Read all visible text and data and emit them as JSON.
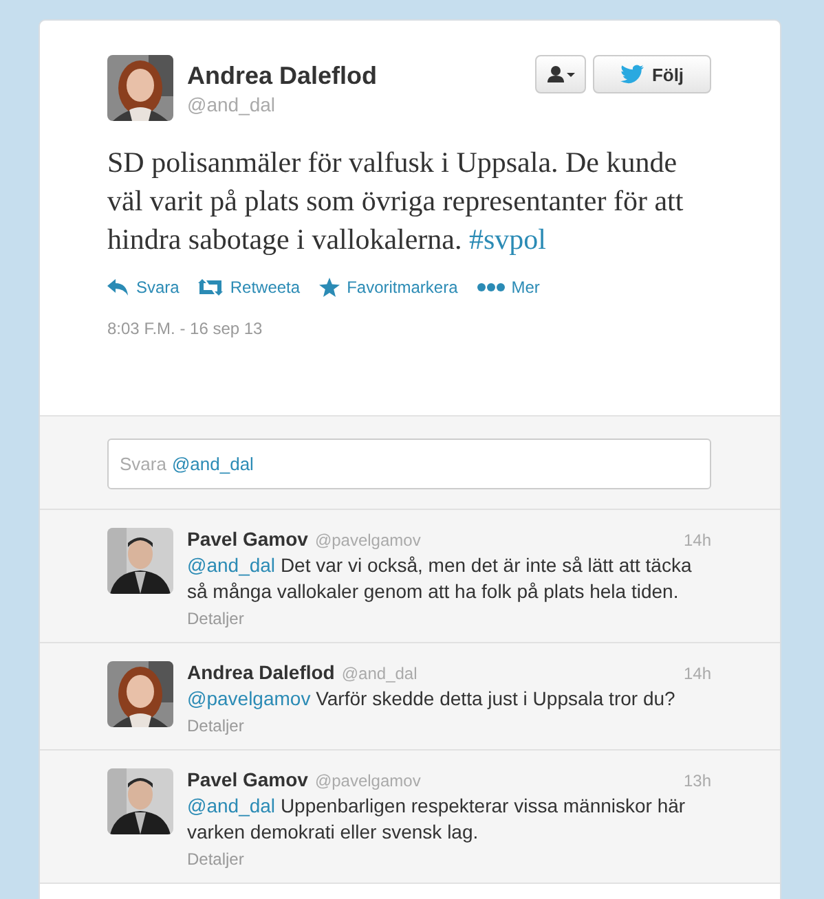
{
  "tweet": {
    "name": "Andrea Daleflod",
    "handle": "@and_dal",
    "follow_button": "Följ",
    "text": "SD polisanmäler för valfusk i Uppsala. De kunde väl varit på plats som övriga representanter för att hindra sabotage i vallokalerna.",
    "hashtag": "#svpol",
    "actions": [
      {
        "kind": "reply",
        "label": "Svara"
      },
      {
        "kind": "retweet",
        "label": "Retweeta"
      },
      {
        "kind": "favorite",
        "label": "Favoritmarkera"
      },
      {
        "kind": "more",
        "label": "Mer"
      }
    ],
    "timestamp": "8:03 F.M. - 16 sep 13"
  },
  "reply_box": {
    "placeholder": "Svara",
    "mention": "@and_dal"
  },
  "replies": [
    {
      "name": "Pavel Gamov",
      "handle": "@pavelgamov",
      "time": "14h",
      "mention": "@and_dal",
      "text": "Det var vi också, men det är inte så lätt att täcka så många vallokaler genom att ha folk på plats hela tiden.",
      "details": "Detaljer"
    },
    {
      "name": "Andrea Daleflod",
      "handle": "@and_dal",
      "time": "14h",
      "mention": "@pavelgamov",
      "text": "Varför skedde detta just i Uppsala tror du?",
      "details": "Detaljer"
    },
    {
      "name": "Pavel Gamov",
      "handle": "@pavelgamov",
      "time": "13h",
      "mention": "@and_dal",
      "text": "Uppenbarligen respekterar vissa människor här varken demokrati eller svensk lag.",
      "details": "Detaljer"
    }
  ]
}
